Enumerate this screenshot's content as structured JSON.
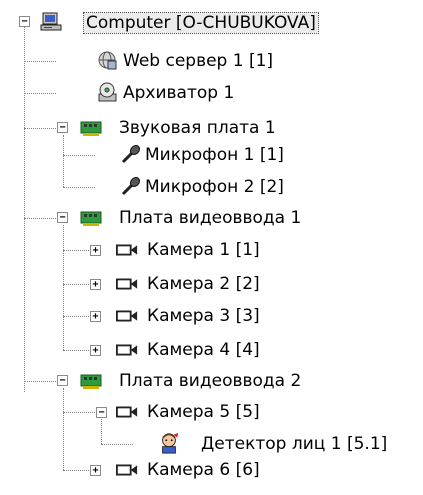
{
  "tree": {
    "root": {
      "label": "Computer [O-CHUBUKOVA]",
      "icon": "computer-icon",
      "expander": "−"
    },
    "web_server": {
      "label": "Web сервер 1 [1]",
      "icon": "web-server-icon"
    },
    "archiver": {
      "label": "Архиватор 1",
      "icon": "archiver-icon"
    },
    "sound_card": {
      "label": "Звуковая плата 1",
      "icon": "board-icon",
      "expander": "−"
    },
    "mic1": {
      "label": "Микрофон 1 [1]",
      "icon": "microphone-icon"
    },
    "mic2": {
      "label": "Микрофон 2 [2]",
      "icon": "microphone-icon"
    },
    "video_card1": {
      "label": "Плата видеоввода 1",
      "icon": "board-icon",
      "expander": "−"
    },
    "cam1": {
      "label": "Камера 1 [1]",
      "icon": "camera-icon",
      "expander": "+"
    },
    "cam2": {
      "label": "Камера 2 [2]",
      "icon": "camera-icon",
      "expander": "+"
    },
    "cam3": {
      "label": "Камера 3 [3]",
      "icon": "camera-icon",
      "expander": "+"
    },
    "cam4": {
      "label": "Камера 4 [4]",
      "icon": "camera-icon",
      "expander": "+"
    },
    "video_card2": {
      "label": "Плата видеоввода 2",
      "icon": "board-icon",
      "expander": "−"
    },
    "cam5": {
      "label": "Камера 5 [5]",
      "icon": "camera-icon",
      "expander": "−"
    },
    "face_detector": {
      "label": "Детектор лиц 1 [5.1]",
      "icon": "face-detector-icon"
    },
    "cam6": {
      "label": "Камера 6 [6]",
      "icon": "camera-icon",
      "expander": "+"
    }
  },
  "colors": {
    "selection_bg": "#ececec",
    "board_green": "#2e9b3c",
    "line": "#808080"
  }
}
